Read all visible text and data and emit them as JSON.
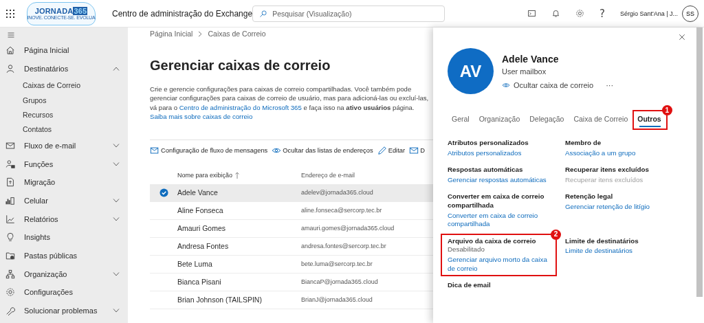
{
  "topbar": {
    "logo_text": "JORNADA",
    "logo_number": "365",
    "logo_tagline": "INOVE. CONECTE-SE. EVOLUA",
    "app_title": "Centro de administração do Exchange",
    "search": {
      "placeholder": "Pesquisar (Visualização)"
    },
    "help": "?",
    "user_name": "Sérgio Sant'Ana | J...",
    "user_initials": "SS"
  },
  "sidebar": {
    "items": [
      {
        "label": "Página Inicial"
      },
      {
        "label": "Destinatários",
        "expanded": true,
        "children": [
          {
            "label": "Caixas de Correio"
          },
          {
            "label": "Grupos"
          },
          {
            "label": "Recursos"
          },
          {
            "label": "Contatos"
          }
        ]
      },
      {
        "label": "Fluxo de e-mail",
        "expanded": false
      },
      {
        "label": "Funções",
        "expanded": false
      },
      {
        "label": "Migração"
      },
      {
        "label": "Celular",
        "expanded": false
      },
      {
        "label": "Relatórios",
        "expanded": false
      },
      {
        "label": "Insights"
      },
      {
        "label": "Pastas públicas"
      },
      {
        "label": "Organização",
        "expanded": false
      },
      {
        "label": "Configurações"
      },
      {
        "label": "Solucionar problemas",
        "expanded": false
      }
    ]
  },
  "main": {
    "breadcrumb": [
      "Página Inicial",
      "Caixas de Correio"
    ],
    "title": "Gerenciar caixas de correio",
    "description": {
      "text_before": "Crie e gerencie configurações para caixas de correio compartilhadas. Você também pode gerenciar configurações para caixas de correio de usuário, mas para adicioná-las ou excluí-las, vá para o",
      "link": "Centro de administração do Microsoft 365",
      "text_after": "e faça isso na **ativo usuários** página."
    },
    "learn_more": "Saiba mais sobre caixas de correio",
    "toolbar": [
      {
        "label": "Configuração de fluxo de mensagens"
      },
      {
        "label": "Ocultar das listas de endereços"
      },
      {
        "label": "Editar"
      },
      {
        "label": "D"
      }
    ],
    "table": {
      "columns": [
        {
          "label": "Nome para exibição",
          "sorted": true
        },
        {
          "label": "Endereço de e-mail",
          "sorted": false
        }
      ],
      "rows": [
        {
          "name": "Adele Vance",
          "email": "adelev@jornada365.cloud",
          "selected": true
        },
        {
          "name": "Aline Fonseca",
          "email": "aline.fonseca@sercorp.tec.br",
          "selected": false
        },
        {
          "name": "Amauri Gomes",
          "email": "amauri.gomes@jornada365.cloud",
          "selected": false
        },
        {
          "name": "Andresa Fontes",
          "email": "andresa.fontes@sercorp.tec.br",
          "selected": false
        },
        {
          "name": "Bete Luma",
          "email": "bete.luma@sercorp.tec.br",
          "selected": false
        },
        {
          "name": "Bianca Pisani",
          "email": "BiancaP@jornada365.cloud",
          "selected": false
        },
        {
          "name": "Brian Johnson (TAILSPIN)",
          "email": "BrianJ@jornada365.cloud",
          "selected": false
        }
      ]
    }
  },
  "panel": {
    "avatar_initials": "AV",
    "name": "Adele Vance",
    "subtitle": "User mailbox",
    "action": "Ocultar caixa de correio",
    "more": "···",
    "tabs": [
      {
        "label": "Geral",
        "selected": false
      },
      {
        "label": "Organização",
        "selected": false
      },
      {
        "label": "Delegação",
        "selected": false
      },
      {
        "label": "Caixa de Correio",
        "selected": false
      },
      {
        "label": "Outros",
        "selected": true,
        "callout": "1"
      }
    ],
    "sections": [
      {
        "title": "Atributos personalizados",
        "link": "Atributos personalizados",
        "disabled": false
      },
      {
        "title": "Membro de",
        "link": "Associação a um grupo",
        "disabled": false
      },
      {
        "title": "Respostas automáticas",
        "link": "Gerenciar respostas automáticas",
        "disabled": false
      },
      {
        "title": "Recuperar itens excluídos",
        "link": "Recuperar itens excluídos",
        "disabled": true
      },
      {
        "title": "Converter em caixa de correio compartilhada",
        "link": "Converter em caixa de correio compartilhada",
        "disabled": false
      },
      {
        "title": "Retenção legal",
        "link": "Gerenciar retenção de litígio",
        "disabled": false
      },
      {
        "title": "Arquivo da caixa de correio",
        "status": "Desabilitado",
        "link": "Gerenciar arquivo morto da caixa de correio",
        "disabled": false,
        "callout": "2"
      },
      {
        "title": "Limite de destinatários",
        "link": "Limite de destinatários",
        "disabled": false
      },
      {
        "title": "Dica de email"
      }
    ]
  }
}
